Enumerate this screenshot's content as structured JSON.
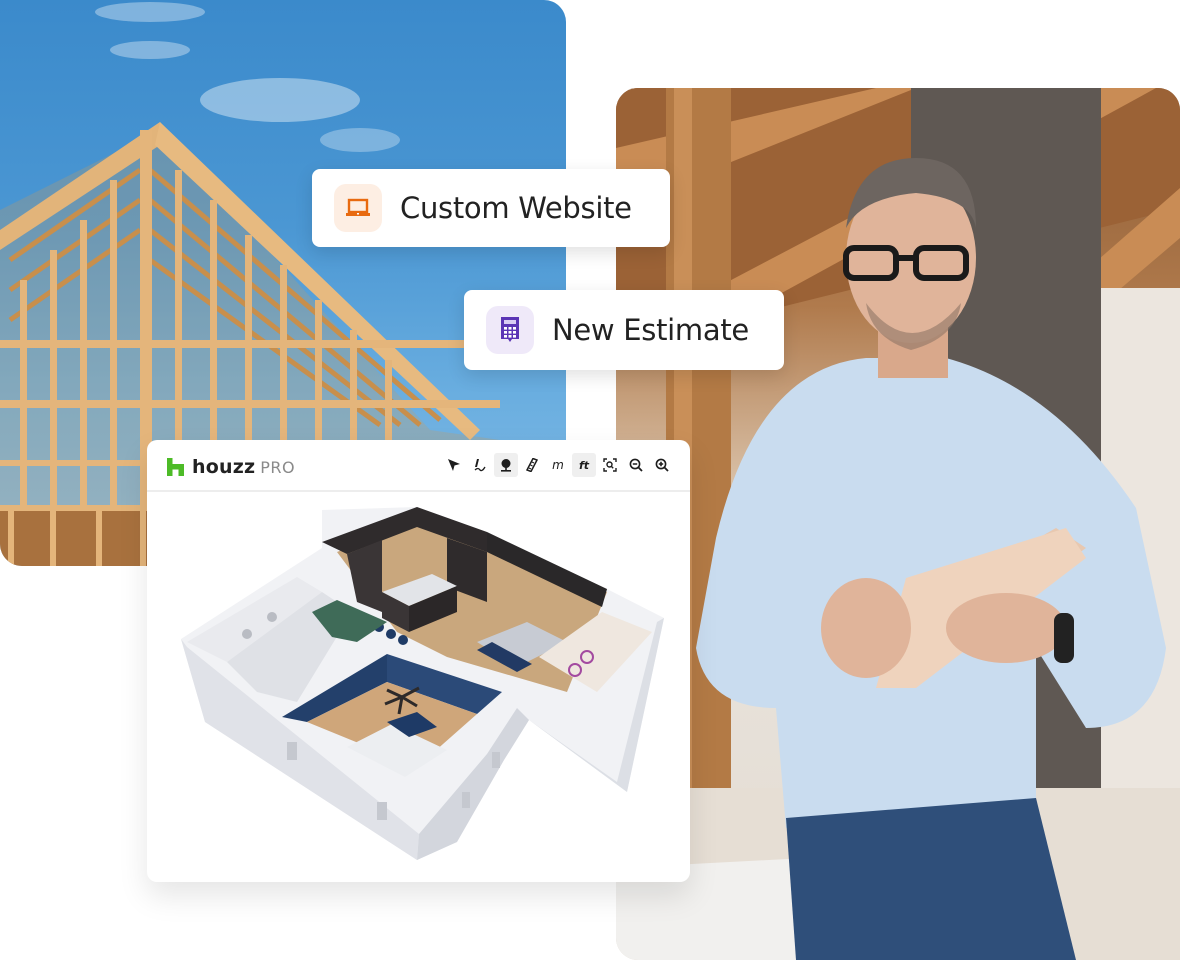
{
  "pills": {
    "website": {
      "label": "Custom Website",
      "icon": "laptop-icon",
      "icon_color": "#e86a10",
      "icon_bg": "#fdeee3"
    },
    "estimate": {
      "label": "New Estimate",
      "icon": "calculator-icon",
      "icon_color": "#5b35b5",
      "icon_bg": "#efe9f9"
    }
  },
  "app": {
    "brand": {
      "name": "houzz",
      "suffix": "PRO",
      "logo_color": "#4dbb27"
    },
    "toolbar": [
      {
        "name": "select-tool",
        "icon": "cursor-arrow-icon",
        "active": false
      },
      {
        "name": "draw-tool",
        "icon": "pen-draw-icon",
        "active": false
      },
      {
        "name": "landscape-tool",
        "icon": "tree-icon",
        "active": true
      },
      {
        "name": "measure-tool",
        "icon": "ruler-icon",
        "active": false
      },
      {
        "name": "unit-meters",
        "label": "m",
        "active": false
      },
      {
        "name": "unit-feet",
        "label": "ft",
        "active": true
      },
      {
        "name": "zoom-fit-tool",
        "icon": "zoom-fit-icon",
        "active": false
      },
      {
        "name": "zoom-out-tool",
        "icon": "zoom-out-icon",
        "active": false
      },
      {
        "name": "zoom-in-tool",
        "icon": "zoom-in-icon",
        "active": false
      }
    ],
    "canvas": {
      "content": "3D floor plan render"
    }
  },
  "photos": {
    "left": "house framing under construction",
    "right": "contractor holding tablet"
  }
}
